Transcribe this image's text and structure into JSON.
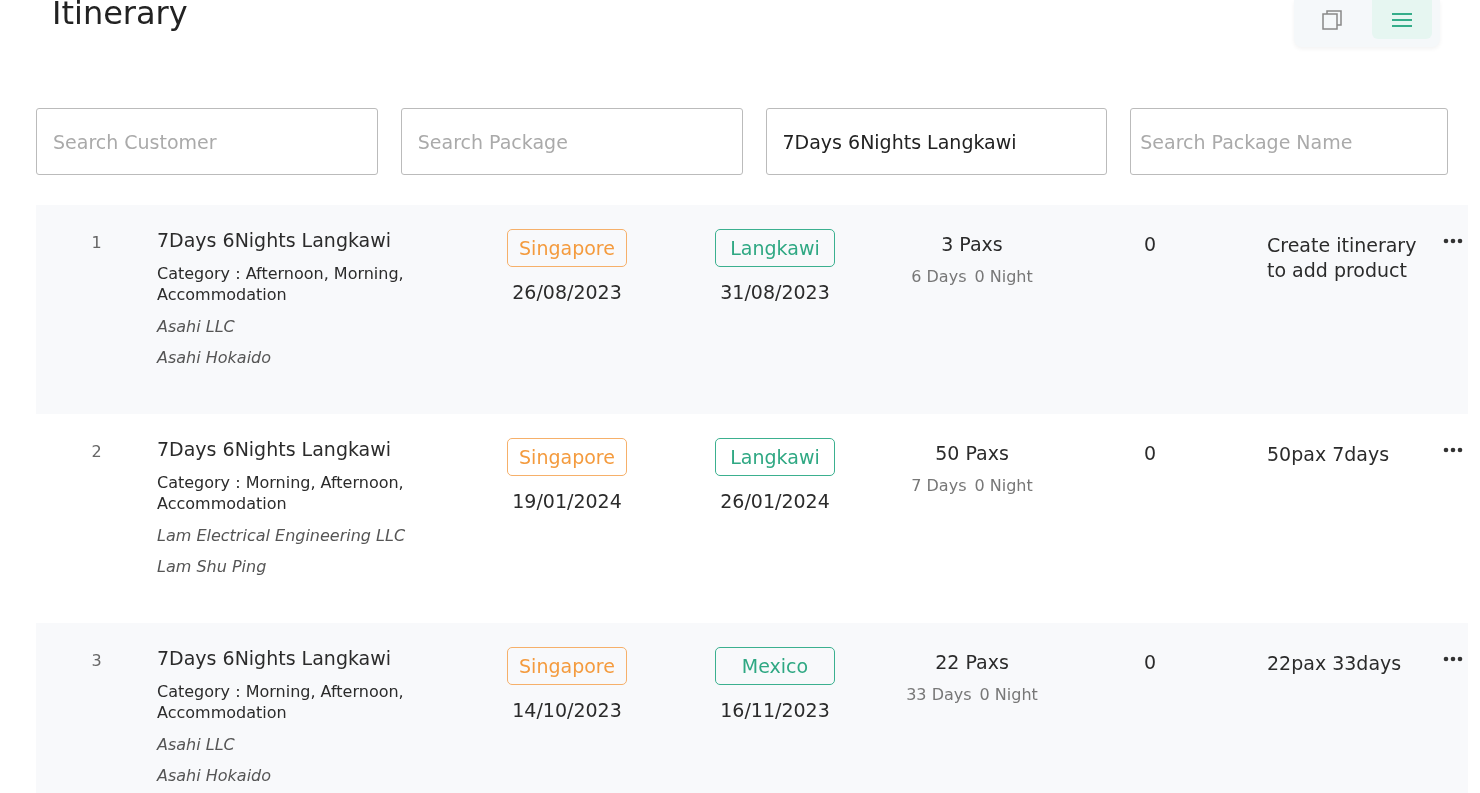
{
  "title": "Itinerary",
  "view_toggle": [
    {
      "kind": "copy",
      "selected": false
    },
    {
      "kind": "list",
      "selected": true
    }
  ],
  "filters": [
    {
      "placeholder": "Search Customer"
    },
    {
      "placeholder": "Search Package"
    },
    {
      "value": "7Days 6Nights Langkawi"
    },
    {
      "placeholder": "Search Package Name"
    }
  ],
  "rows": [
    {
      "index": "1",
      "package": "7Days 6Nights Langkawi",
      "category": "Category : Afternoon, Morning, Accommodation",
      "company": "Asahi LLC",
      "contact": "Asahi Hokaido",
      "from": "Singapore",
      "from_date": "26/08/2023",
      "to": "Langkawi",
      "to_date": "31/08/2023",
      "paxs": "3 Paxs",
      "days": "6 Days",
      "nights": "0 Night",
      "count": "0",
      "note": "Create itinerary to add product"
    },
    {
      "index": "2",
      "package": "7Days 6Nights Langkawi",
      "category": "Category : Morning, Afternoon, Accommodation",
      "company": "Lam Electrical Engineering LLC",
      "contact": "Lam Shu Ping",
      "from": "Singapore",
      "from_date": "19/01/2024",
      "to": "Langkawi",
      "to_date": "26/01/2024",
      "paxs": "50 Paxs",
      "days": "7 Days",
      "nights": "0 Night",
      "count": "0",
      "note": "50pax 7days"
    },
    {
      "index": "3",
      "package": "7Days 6Nights Langkawi",
      "category": "Category : Morning, Afternoon, Accommodation",
      "company": "Asahi LLC",
      "contact": "Asahi Hokaido",
      "from": "Singapore",
      "from_date": "14/10/2023",
      "to": "Mexico",
      "to_date": "16/11/2023",
      "paxs": "22 Paxs",
      "days": "33 Days",
      "nights": "0 Night",
      "count": "0",
      "note": "22pax 33days"
    }
  ]
}
